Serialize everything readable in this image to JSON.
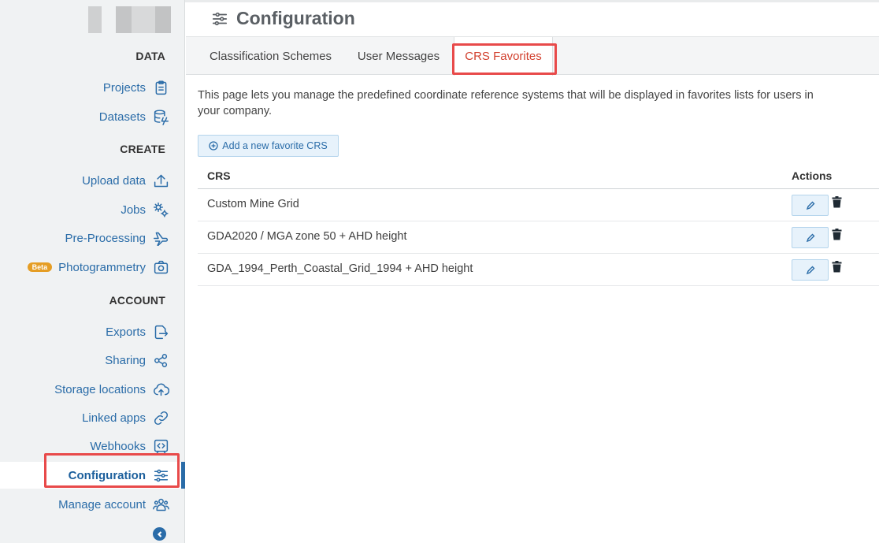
{
  "sidebar": {
    "sections": {
      "data": "DATA",
      "create": "CREATE",
      "account": "ACCOUNT"
    },
    "items": [
      {
        "label": "Projects",
        "icon": "clipboard-icon"
      },
      {
        "label": "Datasets",
        "icon": "database-icon"
      },
      {
        "label": "Upload data",
        "icon": "upload-icon"
      },
      {
        "label": "Jobs",
        "icon": "gears-icon"
      },
      {
        "label": "Pre-Processing",
        "icon": "plane-icon"
      },
      {
        "label": "Photogrammetry",
        "icon": "camera-icon",
        "badge": "Beta"
      },
      {
        "label": "Exports",
        "icon": "file-export-icon"
      },
      {
        "label": "Sharing",
        "icon": "share-icon"
      },
      {
        "label": "Storage locations",
        "icon": "cloud-upload-icon"
      },
      {
        "label": "Linked apps",
        "icon": "link-icon"
      },
      {
        "label": "Webhooks",
        "icon": "code-icon"
      },
      {
        "label": "Configuration",
        "icon": "sliders-icon",
        "active": true
      },
      {
        "label": "Manage account",
        "icon": "users-icon"
      }
    ]
  },
  "header": {
    "title": "Configuration",
    "icon": "sliders-icon"
  },
  "tabs": [
    {
      "label": "Classification Schemes"
    },
    {
      "label": "User Messages"
    },
    {
      "label": "CRS Favorites",
      "active": true
    }
  ],
  "content": {
    "description": "This page lets you manage the predefined coordinate reference systems that will be displayed in favorites lists for users in your company.",
    "add_button": "Add a new favorite CRS",
    "table": {
      "headers": {
        "crs": "CRS",
        "actions": "Actions"
      },
      "rows": [
        {
          "crs": "Custom Mine Grid"
        },
        {
          "crs": "GDA2020 / MGA zone 50 + AHD height"
        },
        {
          "crs": "GDA_1994_Perth_Coastal_Grid_1994 + AHD height"
        }
      ]
    }
  },
  "colors": {
    "accent": "#2a6ca8",
    "active_tab": "#d2402e",
    "highlight": "#e84a4a",
    "beta_badge": "#e59d24"
  }
}
